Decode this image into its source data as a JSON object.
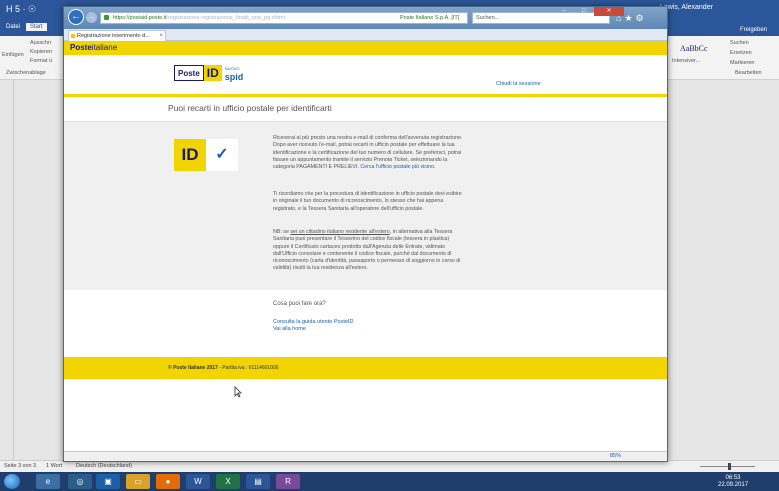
{
  "word": {
    "qat": "H 5 · ☉",
    "user": "Lewis, Alexander",
    "tabs": [
      "Datei",
      "Start"
    ],
    "clipboard": {
      "paste": "Einfügen",
      "cut": "Ausschn",
      "copy": "Kopieren",
      "format": "Format ü",
      "group": "Zwischenablage"
    },
    "styles": {
      "preview": "AaBbCc",
      "style_name": "Intensiver..."
    },
    "editing": {
      "search": "Suchen",
      "replace": "Ersetzen",
      "select": "Markieren",
      "group": "Bearbeiten"
    },
    "share": "Freigeben",
    "status": {
      "page": "Seite 3 von 3",
      "words": "1 Wort",
      "language": "Deutsch (Deutschland)"
    }
  },
  "taskbar": {
    "time": "06:53",
    "date": "22.09.2017"
  },
  "browser": {
    "url_host": "https://postaid.poste.it",
    "url_path": "/registrazione-registrazione_finalit_ona_pg.shtml",
    "site_identity": "Poste Italiane S.p.A. [IT]",
    "search_placeholder": "Suchen...",
    "tab_title": "Registrazione inserimento d...",
    "zoom": "85%"
  },
  "page": {
    "brand_bold": "Poste",
    "brand_rest": "italiane",
    "logo_poste": "Poste",
    "logo_id": "ID",
    "logo_nuovo": "NUOVO",
    "logo_spid": "spid",
    "logout": "Chiudi la sessione",
    "title": "Puoi recarti in ufficio postale per identificarti",
    "badge_text": "ID",
    "check_glyph": "✓",
    "p1": "Riceverai al più presto una nostra e-mail di conferma dell'avvenuta registrazione. Dopo aver ricevuto l'e-mail, potrai recarti in ufficio postale per effettuare la tua identificazione e la certificazione del tuo numero di cellulare. Se preferisci, potrai fissare un appuntamento tramite il servizio Prenota Ticket, selezionando la categoria PAGAMENTI E PRELIEVI.",
    "p1_link": "Cerca l'ufficio postale più vicino.",
    "p2": "Ti ricordiamo che per la procedura di identificazione in ufficio postale devi esibire in originale il tuo documento di riconoscimento, lo stesso che hai appena registrato, e la Tessera Sanitaria all'operatore dell'ufficio postale.",
    "p3_a": "NB: se ",
    "p3_link": "sei un cittadino italiano residente all'estero",
    "p3_b": ", in alternativa alla Tessera Sanitaria puoi presentare il Tesserino del codice fiscale (tessera in plastica) oppure il Certificato cartaceo prodotto dall'Agenzia delle Entrate, vidimato dall'Ufficio consolare e contenente il codice fiscale, purché dal documento di riconoscimento (carta d'identità, passaporto o permesso di soggiorno in corso di validità) risulti la tua residenza all'estero.",
    "next_title": "Cosa puoi fare ora?",
    "link_guide": "Consulta la guida utente PosteID",
    "link_home": "Vai alla home",
    "footer_bold": "© Poste Italiane 2017",
    "footer_rest": " - Partita iva : 01114601006"
  }
}
